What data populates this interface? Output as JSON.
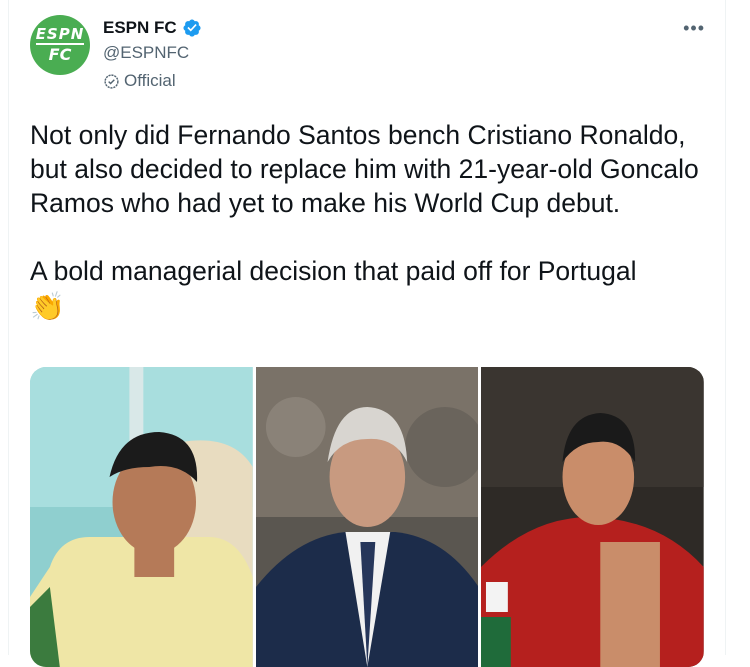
{
  "account": {
    "display_name": "ESPN FC",
    "handle": "@ESPNFC",
    "label": "Official",
    "avatar_text_top": "ESPN",
    "avatar_text_bottom": "FC",
    "brand_color": "#4aad52",
    "verified_color": "#1d9bf0"
  },
  "tweet": {
    "paragraph1": "Not only did Fernando Santos bench Cristiano Ronaldo, but also decided to replace him with 21-year-old Goncalo Ramos who had yet to make his World Cup debut.",
    "paragraph2": "A bold managerial decision that paid off for Portugal",
    "emoji": "👏"
  },
  "icons": {
    "more": "more-options-icon",
    "verified": "verified-badge-icon",
    "official": "official-label-icon"
  },
  "media": [
    {
      "name": "ronaldo-photo"
    },
    {
      "name": "santos-photo"
    },
    {
      "name": "ramos-photo"
    }
  ]
}
